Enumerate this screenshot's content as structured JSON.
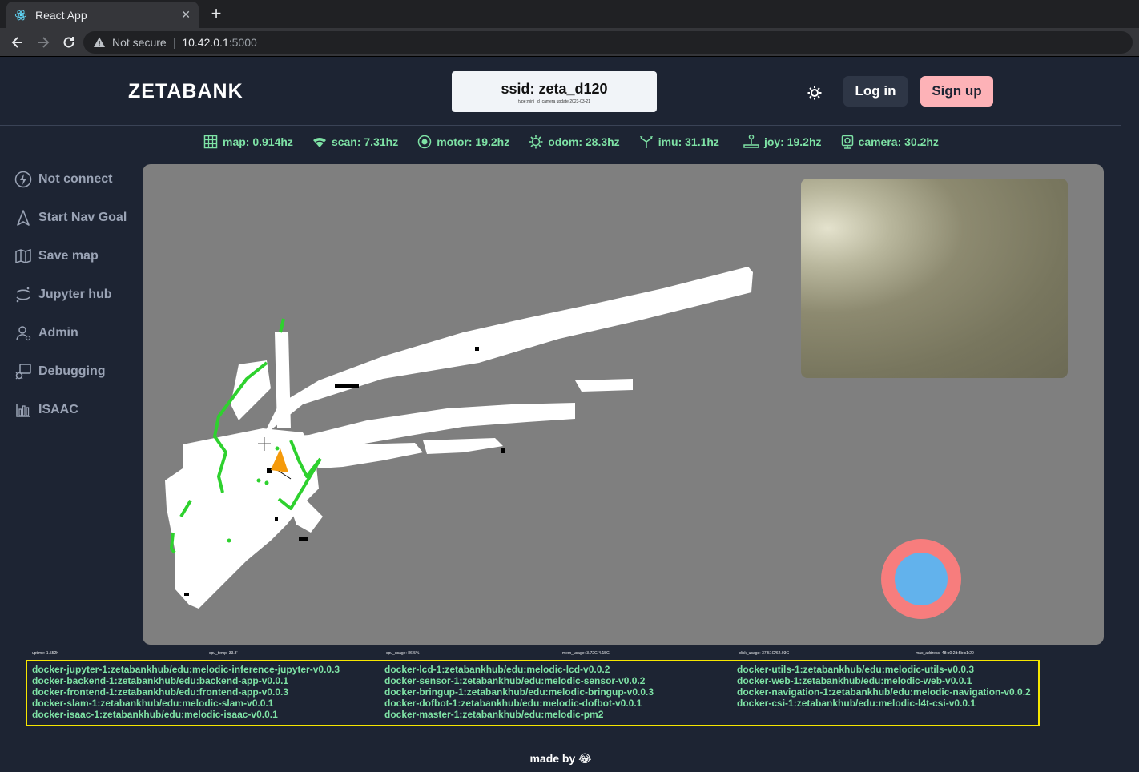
{
  "browser": {
    "tab_title": "React App",
    "tab_close": "✕",
    "new_tab": "+",
    "security_label": "Not secure",
    "url_host": "10.42.0.1",
    "url_port": ":5000"
  },
  "header": {
    "logo": "ZETABANK",
    "ssid": "ssid: zeta_d120",
    "ssid_sub": "type:mini_ld_camera update:2023-03-21",
    "login_label": "Log in",
    "signup_label": "Sign up"
  },
  "status": [
    {
      "label": "map: 0.914hz",
      "icon": "grid-icon"
    },
    {
      "label": "scan: 7.31hz",
      "icon": "wifi-icon"
    },
    {
      "label": "motor: 19.2hz",
      "icon": "motor-icon"
    },
    {
      "label": "odom: 28.3hz",
      "icon": "gear-icon"
    },
    {
      "label": "imu: 31.1hz",
      "icon": "axes-icon"
    },
    {
      "label": "joy: 19.2hz",
      "icon": "joystick-icon"
    },
    {
      "label": "camera: 30.2hz",
      "icon": "camera-icon"
    }
  ],
  "sidebar": {
    "items": [
      {
        "label": "Not connect",
        "icon": "bolt-icon"
      },
      {
        "label": "Start Nav Goal",
        "icon": "navigation-icon"
      },
      {
        "label": "Save map",
        "icon": "map-icon"
      },
      {
        "label": "Jupyter hub",
        "icon": "jupyter-icon"
      },
      {
        "label": "Admin",
        "icon": "user-icon"
      },
      {
        "label": "Debugging",
        "icon": "debug-icon"
      },
      {
        "label": "ISAAC",
        "icon": "chart-icon"
      }
    ]
  },
  "sysinfo": {
    "uptime": "uptime: 1.552h",
    "cpu_temp": "cpu_temp: 33.3'",
    "cpu_usage": "cpu_usage: 86.5%",
    "mem_usage": "mem_usage: 3.72G/4.15G",
    "disk_usage": "disk_usage: 37.51G/62.93G",
    "mac_address": "mac_address: 48:b0:2d:5b:c1:20"
  },
  "docker": {
    "col1": [
      "docker-jupyter-1:zetabankhub/edu:melodic-inference-jupyter-v0.0.3",
      "docker-backend-1:zetabankhub/edu:backend-app-v0.0.1",
      "docker-frontend-1:zetabankhub/edu:frontend-app-v0.0.3",
      "docker-slam-1:zetabankhub/edu:melodic-slam-v0.0.1",
      "docker-isaac-1:zetabankhub/edu:melodic-isaac-v0.0.1"
    ],
    "col2": [
      "docker-lcd-1:zetabankhub/edu:melodic-lcd-v0.0.2",
      "docker-sensor-1:zetabankhub/edu:melodic-sensor-v0.0.2",
      "docker-bringup-1:zetabankhub/edu:melodic-bringup-v0.0.3",
      "docker-dofbot-1:zetabankhub/edu:melodic-dofbot-v0.0.1",
      "docker-master-1:zetabankhub/edu:melodic-pm2"
    ],
    "col3": [
      "docker-utils-1:zetabankhub/edu:melodic-utils-v0.0.3",
      "docker-web-1:zetabankhub/edu:melodic-web-v0.0.1",
      "docker-navigation-1:zetabankhub/edu:melodic-navigation-v0.0.2",
      "docker-csi-1:zetabankhub/edu:melodic-l4t-csi-v0.0.1"
    ]
  },
  "footer": {
    "text": "made by 😂"
  },
  "colors": {
    "accent_green": "#7ee2a5",
    "joystick_outer": "#f77d7d",
    "joystick_inner": "#62b2ec",
    "robot": "#f59a0b"
  }
}
